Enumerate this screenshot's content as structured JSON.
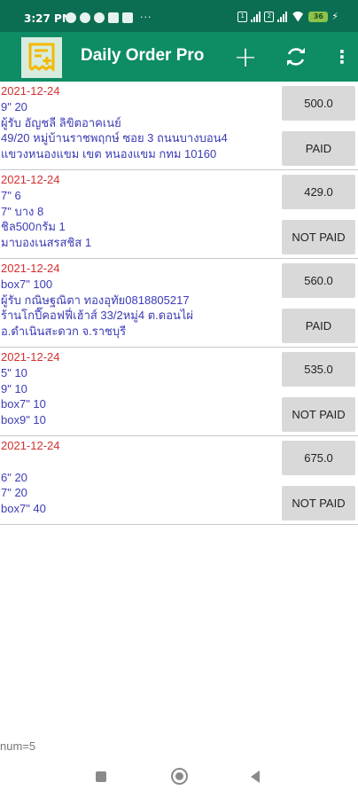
{
  "status_bar": {
    "time": "3:27 PM",
    "left_icons": [
      "settings-icon",
      "circle-icon",
      "p-icon",
      "mail-icon",
      "heart-icon"
    ],
    "dots": "···",
    "battery": "36",
    "sim1": "1",
    "sim2": "2"
  },
  "app_bar": {
    "title": "Daily Order Pro",
    "add_label": "+",
    "more_label": "⋮",
    "accent": "#0e8c66",
    "status_color": "#0b6e52"
  },
  "orders": [
    {
      "date": "2021-12-24",
      "lines": [
        "9\" 20",
        "ผู้รับ อัญชลี ลิขิตอาคเนย์",
        "49/20 หมู่บ้านราชพฤกษ์ ซอย 3 ถนนบางบอน4",
        "แขวงหนองแขม เขต หนองแขม กทม 10160"
      ],
      "amount": "500.0",
      "status": "PAID"
    },
    {
      "date": "2021-12-24",
      "lines": [
        "7\" 6",
        "7\" บาง 8",
        "ชิล500กรัม 1",
        "มาบองเนสรสชิส 1"
      ],
      "amount": "429.0",
      "status": "NOT PAID"
    },
    {
      "date": "2021-12-24",
      "lines": [
        "box7\" 100",
        "ผู้รับ กณิษฐณิตา ทองอุทัย0818805217",
        "ร้านโกปี๊คอฟฟี่เฮ้าส์ 33/2หมู่4 ต.ดอนไผ่",
        "อ.ดำเนินสะดวก จ.ราชบุรี"
      ],
      "amount": "560.0",
      "status": "PAID"
    },
    {
      "date": "2021-12-24",
      "lines": [
        "5\" 10",
        "9\" 10",
        "box7\" 10",
        "box9\" 10"
      ],
      "amount": "535.0",
      "status": "NOT PAID"
    },
    {
      "date": "2021-12-24",
      "lines": [
        "",
        "6\" 20",
        "7\" 20",
        "box7\" 40"
      ],
      "amount": "675.0",
      "status": "NOT PAID"
    }
  ],
  "footer": {
    "count": "num=5"
  },
  "colors": {
    "date": "#d32f2f",
    "item_text": "#3b3bb5",
    "button_bg": "#d9d9d9"
  }
}
